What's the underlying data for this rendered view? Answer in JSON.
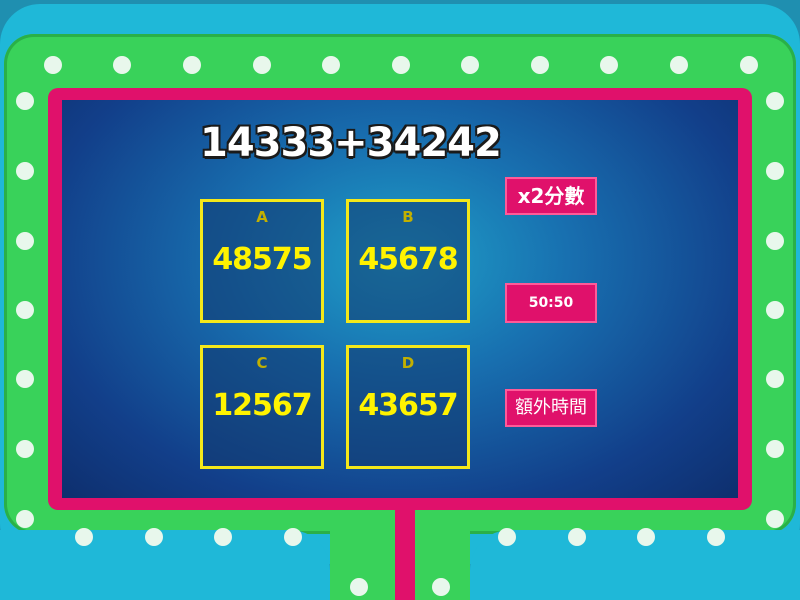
{
  "question": "14333+34242",
  "answers": [
    {
      "letter": "A",
      "value": "48575"
    },
    {
      "letter": "B",
      "value": "45678"
    },
    {
      "letter": "C",
      "value": "12567"
    },
    {
      "letter": "D",
      "value": "43657"
    }
  ],
  "powerups": {
    "double_score": "x2分數",
    "fifty_fifty": "50:50",
    "extra_time": "額外時間"
  },
  "colors": {
    "frame_green": "#39d25a",
    "frame_pink": "#e0116b",
    "answer_border": "#f4e81a",
    "answer_text": "#fff300",
    "screen_blue": "#123f8a"
  }
}
